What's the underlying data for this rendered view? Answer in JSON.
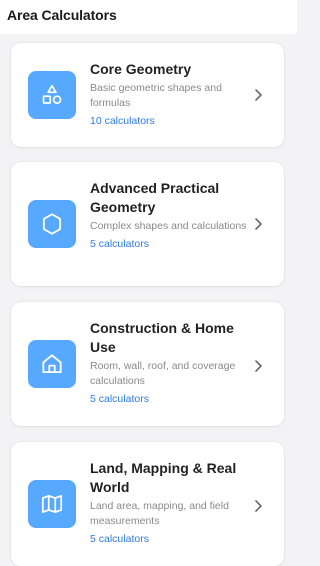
{
  "header": {
    "title": "Area Calculators"
  },
  "categories": [
    {
      "title": "Core Geometry",
      "description": "Basic geometric shapes and formulas",
      "count": "10 calculators",
      "icon": "shapes-icon"
    },
    {
      "title": "Advanced Practical Geometry",
      "description": "Complex shapes and calculations",
      "count": "5 calculators",
      "icon": "hexagon-icon"
    },
    {
      "title": "Construction & Home Use",
      "description": "Room, wall, roof, and coverage calculations",
      "count": "5 calculators",
      "icon": "home-icon"
    },
    {
      "title": "Land, Mapping & Real World",
      "description": "Land area, mapping, and field measurements",
      "count": "5 calculators",
      "icon": "map-icon"
    }
  ],
  "colors": {
    "accent": "#57a8ff",
    "count_text": "#2f7ae5",
    "background": "#f3f3f5",
    "card": "#ffffff"
  }
}
